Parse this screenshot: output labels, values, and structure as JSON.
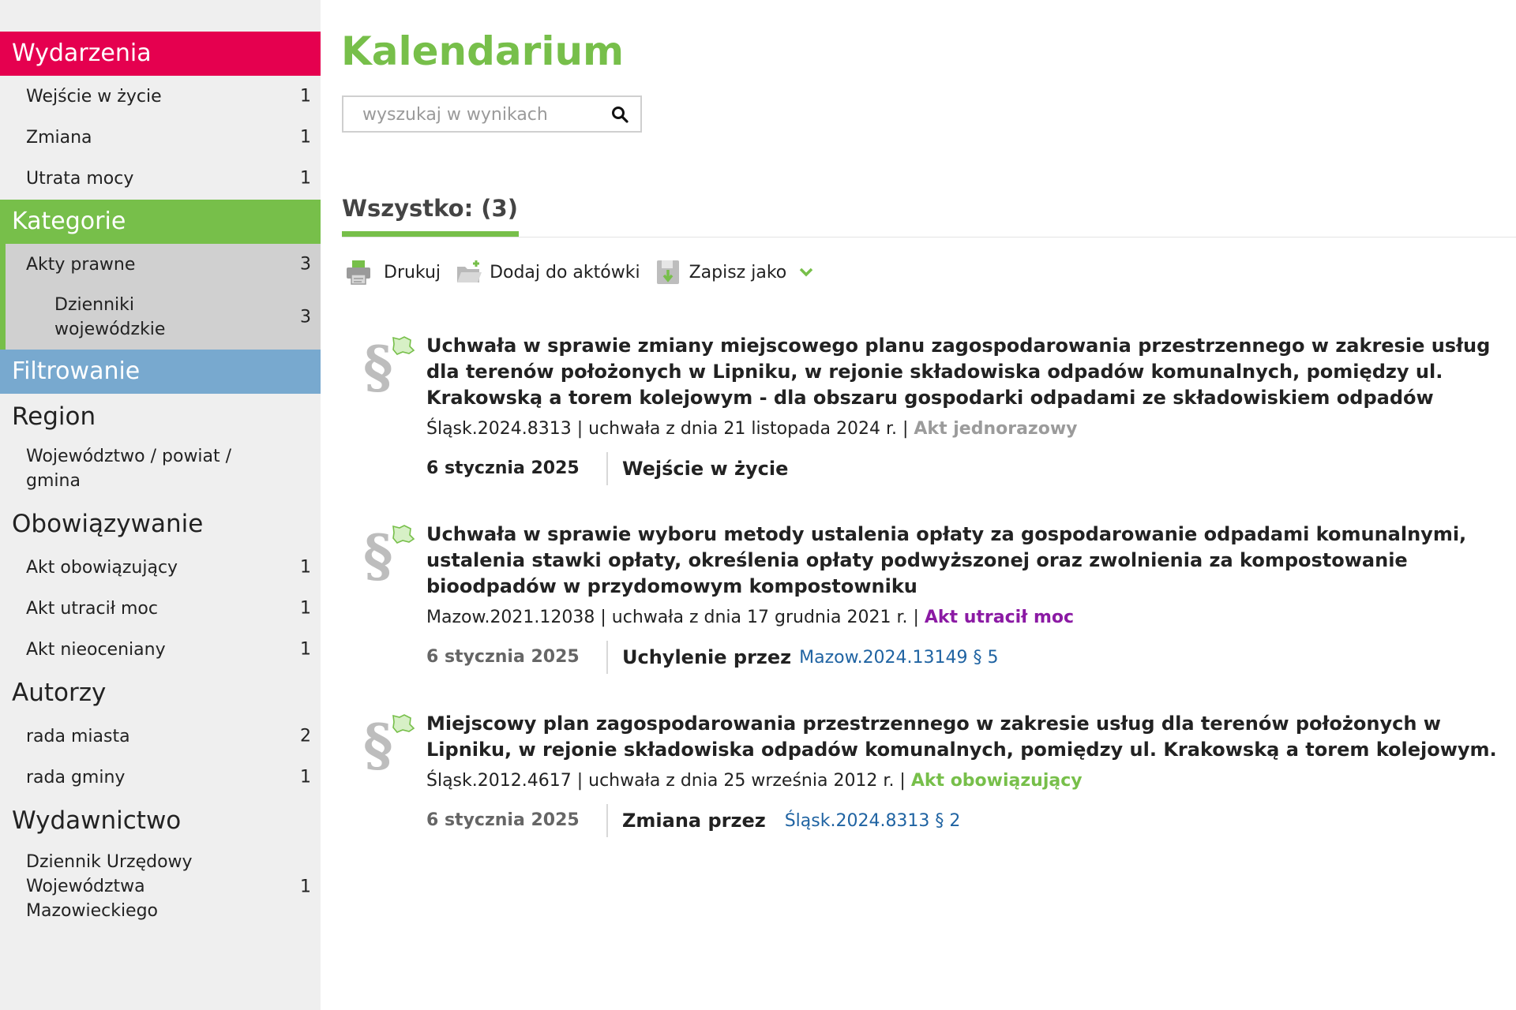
{
  "sidebar": {
    "events": {
      "title": "Wydarzenia",
      "items": [
        {
          "label": "Wejście w życie",
          "count": "1"
        },
        {
          "label": "Zmiana",
          "count": "1"
        },
        {
          "label": "Utrata mocy",
          "count": "1"
        }
      ]
    },
    "categories": {
      "title": "Kategorie",
      "items": [
        {
          "label": "Akty prawne",
          "count": "3"
        },
        {
          "label": "Dzienniki wojewódzkie",
          "count": "3"
        }
      ]
    },
    "filtering": {
      "title": "Filtrowanie",
      "region": {
        "title": "Region",
        "item": "Województwo / powiat / gmina"
      },
      "validity": {
        "title": "Obowiązywanie",
        "items": [
          {
            "label": "Akt obowiązujący",
            "count": "1"
          },
          {
            "label": "Akt utracił moc",
            "count": "1"
          },
          {
            "label": "Akt nieoceniany",
            "count": "1"
          }
        ]
      },
      "authors": {
        "title": "Autorzy",
        "items": [
          {
            "label": "rada miasta",
            "count": "2"
          },
          {
            "label": "rada gminy",
            "count": "1"
          }
        ]
      },
      "publisher": {
        "title": "Wydawnictwo",
        "items": [
          {
            "label": "Dziennik Urzędowy Województwa Mazowieckiego",
            "count": "1"
          }
        ]
      }
    }
  },
  "main": {
    "title": "Kalendarium",
    "search": {
      "placeholder": "wyszukaj w wynikach",
      "value": ""
    },
    "tab": {
      "label": "Wszystko: (3)"
    },
    "toolbar": {
      "print": "Drukuj",
      "add": "Dodaj do aktówki",
      "save": "Zapisz jako"
    },
    "results": [
      {
        "title": "Uchwała w sprawie zmiany miejscowego planu zagospodarowania przestrzennego w zakresie usług dla terenów położonych w Lipniku, w rejonie składowiska odpadów komunalnych, pomiędzy ul. Krakowską a torem kolejowym - dla obszaru gospodarki odpadami ze składowiskiem odpadów",
        "meta": "Śląsk.2024.8313 | uchwała z dnia 21 listopada 2024 r. |",
        "status": "Akt jednorazowy",
        "date": "6 stycznia 2025",
        "event": "Wejście w życie",
        "link": ""
      },
      {
        "title": "Uchwała w sprawie wyboru metody ustalenia opłaty za gospodarowanie odpadami komunalnymi, ustalenia stawki opłaty, określenia opłaty podwyższonej oraz zwolnienia za kompostowanie bioodpadów w przydomowym kompostowniku",
        "meta": "Mazow.2021.12038 | uchwała z dnia 17 grudnia 2021 r. |",
        "status": "Akt utracił moc",
        "date": "6 stycznia 2025",
        "event": "Uchylenie przez",
        "link": "Mazow.2024.13149 § 5"
      },
      {
        "title": "Miejscowy plan zagospodarowania przestrzennego w zakresie usług dla terenów położonych w Lipniku, w rejonie składowiska odpadów komunalnych, pomiędzy ul. Krakowską a torem kolejowym.",
        "meta": "Śląsk.2012.4617 | uchwała z dnia 25 września 2012 r. |",
        "status": "Akt obowiązujący",
        "date": "6 stycznia 2025",
        "event": "Zmiana przez",
        "link": "Śląsk.2024.8313 § 2"
      }
    ]
  },
  "colors": {
    "events": "#e5004f",
    "categories": "#77bf4a",
    "filtering": "#78a9cf",
    "status_one_time": "#9b9b9b",
    "status_expired": "#8b1aa4",
    "status_valid": "#77bf4a",
    "link": "#1f63a2"
  },
  "icons": [
    "search-icon",
    "printer-icon",
    "folder-icon",
    "save-icon",
    "chevron-down-icon",
    "paragraph-icon",
    "map-icon"
  ]
}
